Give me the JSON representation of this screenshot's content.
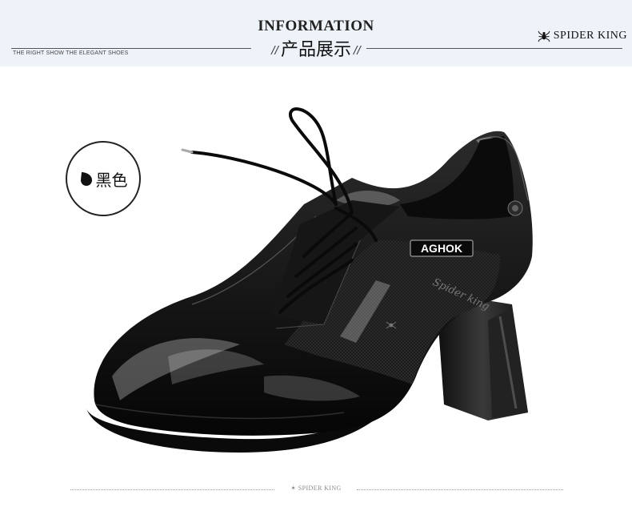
{
  "header": {
    "title": "INFORMATION",
    "subtitle": "产品展示",
    "slash": "//",
    "tagline": "THE RIGHT SHOW THE ELEGANT SHOES",
    "brand": "SPIDER KING"
  },
  "color_badge": {
    "label": "黑色",
    "swatch_color": "#111111"
  },
  "product": {
    "logo_text": "AGHOK",
    "mesh_script": "Spider king",
    "icon": "shoe-image"
  },
  "footer": {
    "brand": "SPIDER KING"
  }
}
